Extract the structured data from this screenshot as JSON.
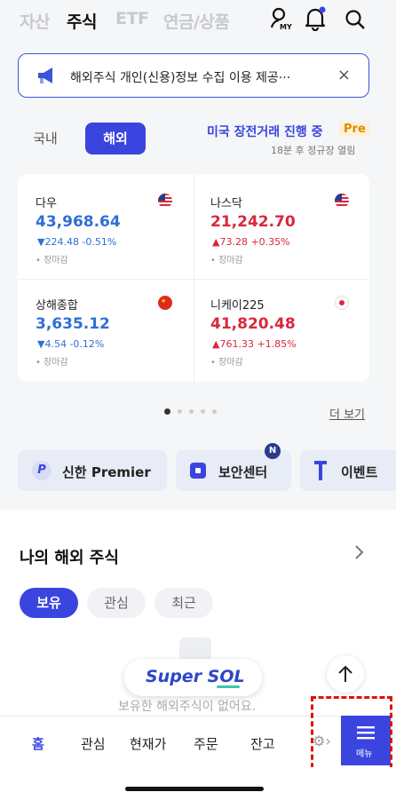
{
  "top_tabs": [
    {
      "label": "자산"
    },
    {
      "label": "주식"
    },
    {
      "label": "ETF"
    },
    {
      "label": "연금/상품"
    }
  ],
  "my_icon_label": "MY",
  "notice": {
    "text": "해외주식 개인(신용)정보 수집 이용 제공···",
    "close": "×"
  },
  "market_toggle": {
    "domestic": "국내",
    "overseas": "해외"
  },
  "market_status": {
    "title": "미국 장전거래 진행 중",
    "badge": "Pre",
    "sub": "18분 후 정규장 열림"
  },
  "indices": [
    {
      "name": "다우",
      "value": "43,968.64",
      "change": "▼224.48 -0.51%",
      "status": "• 장마감",
      "flag": "us-flag-icon"
    },
    {
      "name": "나스닥",
      "value": "21,242.70",
      "change": "▲73.28 +0.35%",
      "status": "• 장마감",
      "flag": "us-flag-icon"
    },
    {
      "name": "상해종합",
      "value": "3,635.12",
      "change": "▼4.54 -0.12%",
      "status": "• 장마감",
      "flag": "cn-flag-icon"
    },
    {
      "name": "니케이225",
      "value": "41,820.48",
      "change": "▲761.33 +1.85%",
      "status": "• 장마감",
      "flag": "jp-flag-icon"
    }
  ],
  "more_link": "더 보기",
  "quick": [
    {
      "label": "신한 Premier"
    },
    {
      "label": "보안센터",
      "badge": "N"
    },
    {
      "label": "이벤트"
    }
  ],
  "my_section": {
    "title": "나의 해외 주식",
    "chips": [
      "보유",
      "관심",
      "최근"
    ],
    "empty_text": "보유한 해외주식이 없어요.",
    "brand": "Super SOL"
  },
  "bottom_nav": [
    "홈",
    "관심",
    "현재가",
    "주문",
    "잔고"
  ],
  "menu_label": "메뉴",
  "colors": {
    "accent": "#3a45e0",
    "up": "#d9283b",
    "down": "#2f6fd6"
  }
}
